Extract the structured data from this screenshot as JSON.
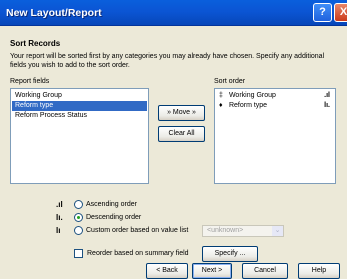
{
  "window": {
    "title": "New Layout/Report",
    "help_glyph": "?",
    "close_glyph": "X"
  },
  "section": {
    "heading": "Sort Records",
    "description": "Your report will be sorted first by any categories you may already have chosen. Specify any additional fields you wish to add to the sort order."
  },
  "report_fields": {
    "label": "Report fields",
    "items": [
      "Working Group",
      "Reform type",
      "Reform Process Status"
    ],
    "selected_index": 1
  },
  "move_buttons": {
    "move_label": "» Move »",
    "clear_label": "Clear All"
  },
  "sort_order": {
    "label": "Sort order",
    "items": [
      {
        "label": "Working Group",
        "prefix": "‡",
        "indicator": ".ıl"
      },
      {
        "label": "Reform type",
        "prefix": "♦",
        "indicator": "lı."
      }
    ]
  },
  "order_options": {
    "ascending": {
      "icon": ".ıl",
      "label": "Ascending order",
      "selected": false
    },
    "descending": {
      "icon": "lı.",
      "label": "Descending order",
      "selected": true
    },
    "custom": {
      "icon": "lı",
      "label": "Custom order based on value list",
      "selected": false,
      "combo_value": "<unknown>"
    }
  },
  "reorder": {
    "label": "Reorder based on summary field",
    "checked": false,
    "specify_label": "Specify ..."
  },
  "footer": {
    "back_label": "< Back",
    "next_label": "Next >",
    "cancel_label": "Cancel",
    "help_label": "Help"
  },
  "colors": {
    "titlebar": "#0b55d4",
    "selection": "#316ac5",
    "dialog_bg": "#ece9d8"
  },
  "icons": {
    "help": "help-icon",
    "close": "close-icon",
    "sort_asc": "ascending-sort-icon",
    "sort_desc": "descending-sort-icon",
    "custom": "custom-sort-icon"
  }
}
